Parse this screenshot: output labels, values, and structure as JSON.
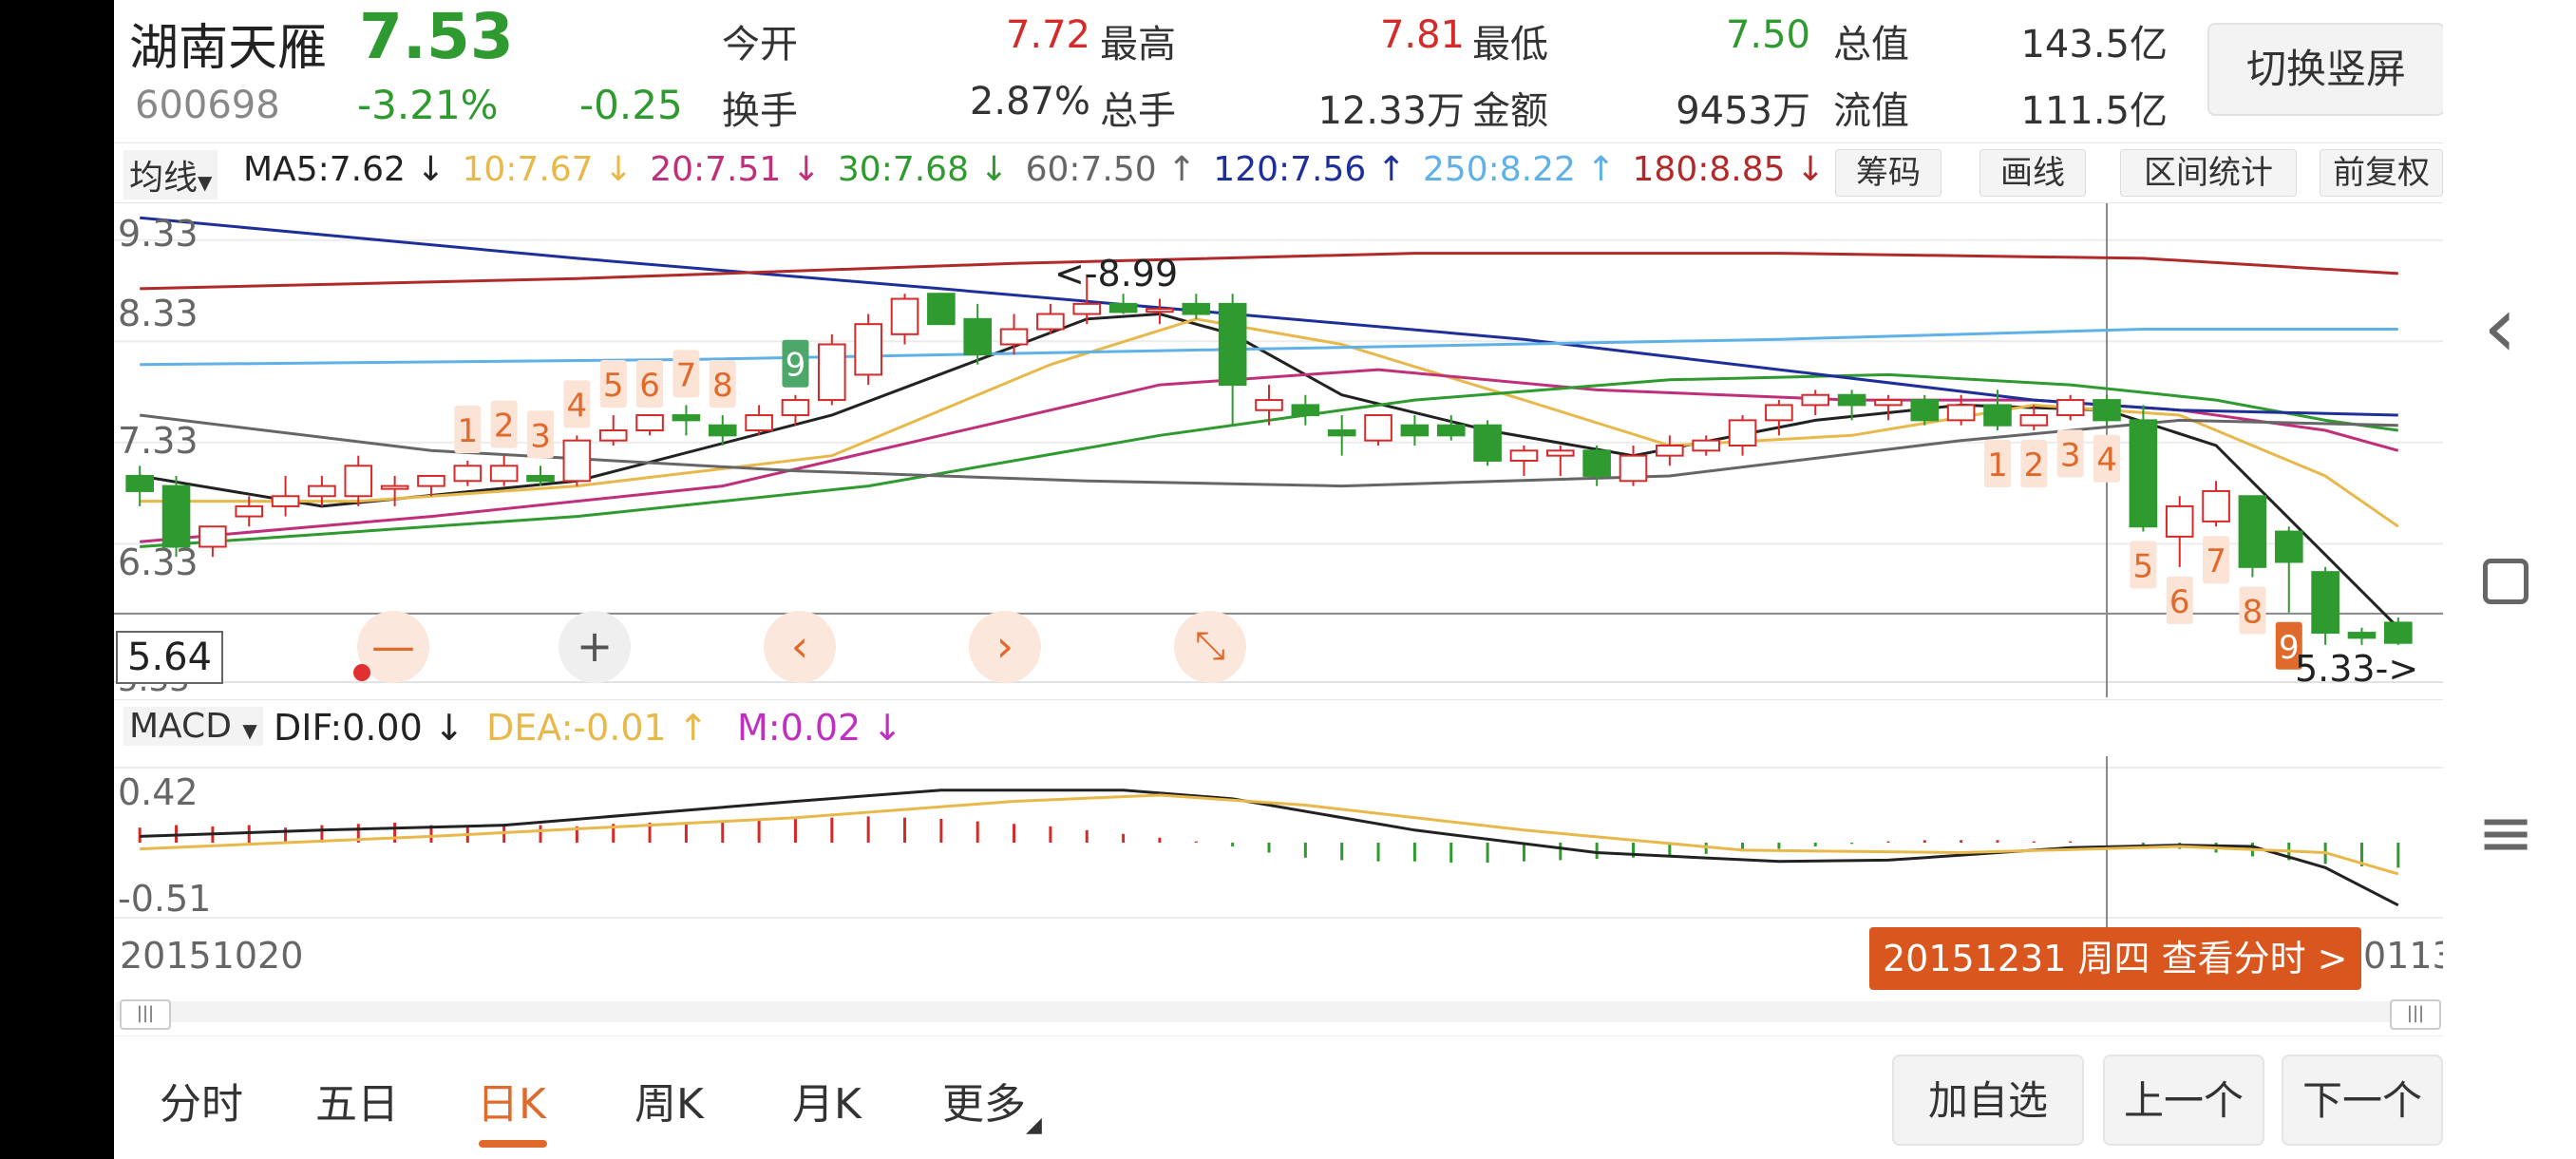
{
  "stock": {
    "name": "湖南天雁",
    "price": "7.53",
    "code": "600698",
    "change_pct": "-3.21%",
    "change": "-0.25"
  },
  "quote": {
    "open_label": "今开",
    "open": "7.72",
    "high_label": "最高",
    "high": "7.81",
    "low_label": "最低",
    "low": "7.50",
    "mcap_label": "总值",
    "mcap": "143.5亿",
    "turnover_label": "换手",
    "turnover": "2.87%",
    "volume_label": "总手",
    "volume": "12.33万",
    "amount_label": "金额",
    "amount": "9453万",
    "float_label": "流值",
    "float": "111.5亿"
  },
  "switch_button": "切换竖屏",
  "ma_bar": {
    "selector": "均线",
    "items": [
      {
        "text": "MA5:7.62 ↓",
        "color": "#222222"
      },
      {
        "text": "10:7.67 ↓",
        "color": "#e8b84a"
      },
      {
        "text": "20:7.51 ↓",
        "color": "#c0307a"
      },
      {
        "text": "30:7.68 ↓",
        "color": "#2f9a2f"
      },
      {
        "text": "60:7.50 ↑",
        "color": "#666666"
      },
      {
        "text": "120:7.56 ↑",
        "color": "#1f2f9a"
      },
      {
        "text": "250:8.22 ↑",
        "color": "#5fb1e8"
      },
      {
        "text": "180:8.85 ↓",
        "color": "#b02a2a"
      }
    ],
    "buttons": [
      "筹码",
      "画线",
      "区间统计",
      "前复权"
    ]
  },
  "chart_axis": {
    "y_ticks": [
      "9.33",
      "8.33",
      "7.33",
      "6.33",
      "5.33"
    ],
    "crosshair_value": "5.64",
    "high_marker": "<-8.99",
    "low_marker": "5.33->"
  },
  "zoom_controls": [
    "—",
    "+",
    "‹",
    "›",
    "⤡"
  ],
  "macd_bar": {
    "selector": "MACD",
    "dif": "DIF:0.00 ↓",
    "dea": "DEA:-0.01 ↑",
    "m": "M:0.02 ↓",
    "y_ticks": [
      "0.42",
      "-0.51"
    ]
  },
  "dates": {
    "start": "20151020",
    "end": "0113",
    "tooltip": "20151231 周四 查看分时 >"
  },
  "colors": {
    "up": "#d52a2a",
    "down": "#2f9a2f",
    "accent": "#e06a2c"
  },
  "chart_data": {
    "type": "candlestick",
    "ylim": [
      5.0,
      9.6
    ],
    "candles": [
      {
        "o": 7.0,
        "h": 7.1,
        "l": 6.7,
        "c": 6.85
      },
      {
        "o": 6.9,
        "h": 7.0,
        "l": 6.2,
        "c": 6.3
      },
      {
        "o": 6.3,
        "h": 6.5,
        "l": 6.2,
        "c": 6.5
      },
      {
        "o": 6.6,
        "h": 6.8,
        "l": 6.5,
        "c": 6.7
      },
      {
        "o": 6.7,
        "h": 7.0,
        "l": 6.6,
        "c": 6.8
      },
      {
        "o": 6.8,
        "h": 7.0,
        "l": 6.7,
        "c": 6.9
      },
      {
        "o": 6.8,
        "h": 7.2,
        "l": 6.7,
        "c": 7.1
      },
      {
        "o": 6.9,
        "h": 7.0,
        "l": 6.7,
        "c": 6.9
      },
      {
        "o": 6.9,
        "h": 7.0,
        "l": 6.8,
        "c": 7.0
      },
      {
        "o": 6.95,
        "h": 7.15,
        "l": 6.9,
        "c": 7.1
      },
      {
        "o": 6.95,
        "h": 7.2,
        "l": 6.9,
        "c": 7.1
      },
      {
        "o": 7.0,
        "h": 7.1,
        "l": 6.9,
        "c": 6.95
      },
      {
        "o": 6.95,
        "h": 7.4,
        "l": 6.9,
        "c": 7.35
      },
      {
        "o": 7.35,
        "h": 7.6,
        "l": 7.3,
        "c": 7.45
      },
      {
        "o": 7.45,
        "h": 7.6,
        "l": 7.4,
        "c": 7.6
      },
      {
        "o": 7.6,
        "h": 7.7,
        "l": 7.4,
        "c": 7.55
      },
      {
        "o": 7.5,
        "h": 7.6,
        "l": 7.3,
        "c": 7.4
      },
      {
        "o": 7.45,
        "h": 7.7,
        "l": 7.4,
        "c": 7.6
      },
      {
        "o": 7.6,
        "h": 7.8,
        "l": 7.5,
        "c": 7.75
      },
      {
        "o": 7.75,
        "h": 8.4,
        "l": 7.7,
        "c": 8.3
      },
      {
        "o": 8.0,
        "h": 8.6,
        "l": 7.9,
        "c": 8.5
      },
      {
        "o": 8.4,
        "h": 8.8,
        "l": 8.3,
        "c": 8.75
      },
      {
        "o": 8.8,
        "h": 8.8,
        "l": 8.5,
        "c": 8.5
      },
      {
        "o": 8.55,
        "h": 8.7,
        "l": 8.1,
        "c": 8.2
      },
      {
        "o": 8.3,
        "h": 8.6,
        "l": 8.2,
        "c": 8.45
      },
      {
        "o": 8.45,
        "h": 8.7,
        "l": 8.4,
        "c": 8.6
      },
      {
        "o": 8.6,
        "h": 8.99,
        "l": 8.5,
        "c": 8.7
      },
      {
        "o": 8.7,
        "h": 8.8,
        "l": 8.6,
        "c": 8.62
      },
      {
        "o": 8.65,
        "h": 8.75,
        "l": 8.5,
        "c": 8.65
      },
      {
        "o": 8.7,
        "h": 8.8,
        "l": 8.55,
        "c": 8.6
      },
      {
        "o": 8.7,
        "h": 8.8,
        "l": 7.5,
        "c": 7.9
      },
      {
        "o": 7.65,
        "h": 7.9,
        "l": 7.5,
        "c": 7.75
      },
      {
        "o": 7.7,
        "h": 7.8,
        "l": 7.5,
        "c": 7.6
      },
      {
        "o": 7.45,
        "h": 7.6,
        "l": 7.2,
        "c": 7.4
      },
      {
        "o": 7.35,
        "h": 7.6,
        "l": 7.3,
        "c": 7.6
      },
      {
        "o": 7.5,
        "h": 7.6,
        "l": 7.3,
        "c": 7.4
      },
      {
        "o": 7.5,
        "h": 7.6,
        "l": 7.35,
        "c": 7.4
      },
      {
        "o": 7.5,
        "h": 7.55,
        "l": 7.1,
        "c": 7.15
      },
      {
        "o": 7.15,
        "h": 7.3,
        "l": 7.0,
        "c": 7.25
      },
      {
        "o": 7.2,
        "h": 7.3,
        "l": 7.0,
        "c": 7.25
      },
      {
        "o": 7.25,
        "h": 7.3,
        "l": 6.9,
        "c": 7.0
      },
      {
        "o": 6.95,
        "h": 7.3,
        "l": 6.9,
        "c": 7.2
      },
      {
        "o": 7.2,
        "h": 7.4,
        "l": 7.1,
        "c": 7.3
      },
      {
        "o": 7.25,
        "h": 7.4,
        "l": 7.2,
        "c": 7.35
      },
      {
        "o": 7.3,
        "h": 7.6,
        "l": 7.2,
        "c": 7.55
      },
      {
        "o": 7.55,
        "h": 7.75,
        "l": 7.4,
        "c": 7.7
      },
      {
        "o": 7.7,
        "h": 7.85,
        "l": 7.6,
        "c": 7.8
      },
      {
        "o": 7.8,
        "h": 7.85,
        "l": 7.55,
        "c": 7.7
      },
      {
        "o": 7.7,
        "h": 7.8,
        "l": 7.55,
        "c": 7.75
      },
      {
        "o": 7.75,
        "h": 7.8,
        "l": 7.5,
        "c": 7.55
      },
      {
        "o": 7.55,
        "h": 7.8,
        "l": 7.5,
        "c": 7.7
      },
      {
        "o": 7.7,
        "h": 7.85,
        "l": 7.45,
        "c": 7.5
      },
      {
        "o": 7.5,
        "h": 7.7,
        "l": 7.45,
        "c": 7.6
      },
      {
        "o": 7.6,
        "h": 7.8,
        "l": 7.55,
        "c": 7.75
      },
      {
        "o": 7.75,
        "h": 7.8,
        "l": 7.5,
        "c": 7.55
      },
      {
        "o": 7.55,
        "h": 7.7,
        "l": 6.45,
        "c": 6.5
      },
      {
        "o": 6.4,
        "h": 6.8,
        "l": 6.1,
        "c": 6.7
      },
      {
        "o": 6.55,
        "h": 6.95,
        "l": 6.5,
        "c": 6.85
      },
      {
        "o": 6.8,
        "h": 6.8,
        "l": 6.0,
        "c": 6.1
      },
      {
        "o": 6.45,
        "h": 6.5,
        "l": 5.65,
        "c": 6.15
      },
      {
        "o": 6.05,
        "h": 6.1,
        "l": 5.33,
        "c": 5.45
      },
      {
        "o": 5.45,
        "h": 5.5,
        "l": 5.33,
        "c": 5.4
      },
      {
        "o": 5.55,
        "h": 5.6,
        "l": 5.33,
        "c": 5.35
      }
    ],
    "ma_series": [
      {
        "name": "MA5",
        "color": "#222222",
        "points": [
          [
            0,
            7.0
          ],
          [
            5,
            6.7
          ],
          [
            12,
            6.95
          ],
          [
            19,
            7.6
          ],
          [
            26,
            8.55
          ],
          [
            28,
            8.6
          ],
          [
            30,
            8.4
          ],
          [
            33,
            7.8
          ],
          [
            37,
            7.45
          ],
          [
            41,
            7.2
          ],
          [
            46,
            7.55
          ],
          [
            50,
            7.7
          ],
          [
            54,
            7.65
          ],
          [
            57,
            7.3
          ],
          [
            62,
            5.5
          ]
        ]
      },
      {
        "name": "MA10",
        "color": "#e8b84a",
        "points": [
          [
            0,
            6.75
          ],
          [
            6,
            6.75
          ],
          [
            12,
            6.9
          ],
          [
            19,
            7.2
          ],
          [
            25,
            8.1
          ],
          [
            29,
            8.55
          ],
          [
            33,
            8.3
          ],
          [
            38,
            7.75
          ],
          [
            42,
            7.3
          ],
          [
            47,
            7.4
          ],
          [
            52,
            7.7
          ],
          [
            56,
            7.6
          ],
          [
            60,
            7.0
          ],
          [
            62,
            6.5
          ]
        ]
      },
      {
        "name": "MA20",
        "color": "#c0307a",
        "points": [
          [
            0,
            6.35
          ],
          [
            8,
            6.6
          ],
          [
            16,
            6.9
          ],
          [
            22,
            7.4
          ],
          [
            28,
            7.9
          ],
          [
            34,
            8.05
          ],
          [
            40,
            7.85
          ],
          [
            47,
            7.75
          ],
          [
            52,
            7.75
          ],
          [
            56,
            7.65
          ],
          [
            60,
            7.45
          ],
          [
            62,
            7.25
          ]
        ]
      },
      {
        "name": "MA30",
        "color": "#2f9a2f",
        "points": [
          [
            0,
            6.3
          ],
          [
            12,
            6.6
          ],
          [
            20,
            6.9
          ],
          [
            28,
            7.4
          ],
          [
            35,
            7.75
          ],
          [
            42,
            7.95
          ],
          [
            48,
            8.0
          ],
          [
            53,
            7.9
          ],
          [
            57,
            7.75
          ],
          [
            60,
            7.55
          ],
          [
            62,
            7.45
          ]
        ]
      },
      {
        "name": "MA60",
        "color": "#666666",
        "points": [
          [
            0,
            7.6
          ],
          [
            8,
            7.25
          ],
          [
            18,
            7.05
          ],
          [
            26,
            6.95
          ],
          [
            33,
            6.9
          ],
          [
            42,
            7.0
          ],
          [
            50,
            7.35
          ],
          [
            56,
            7.55
          ],
          [
            62,
            7.5
          ]
        ]
      },
      {
        "name": "MA120",
        "color": "#1f2f9a",
        "points": [
          [
            0,
            9.55
          ],
          [
            12,
            9.15
          ],
          [
            22,
            8.85
          ],
          [
            30,
            8.6
          ],
          [
            38,
            8.35
          ],
          [
            45,
            8.05
          ],
          [
            52,
            7.75
          ],
          [
            56,
            7.65
          ],
          [
            62,
            7.6
          ]
        ]
      },
      {
        "name": "MA250",
        "color": "#5fb1e8",
        "points": [
          [
            0,
            8.1
          ],
          [
            15,
            8.15
          ],
          [
            30,
            8.25
          ],
          [
            45,
            8.35
          ],
          [
            55,
            8.45
          ],
          [
            62,
            8.45
          ]
        ]
      },
      {
        "name": "MA180",
        "color": "#b02a2a",
        "points": [
          [
            0,
            8.85
          ],
          [
            12,
            8.95
          ],
          [
            24,
            9.1
          ],
          [
            35,
            9.2
          ],
          [
            45,
            9.2
          ],
          [
            55,
            9.15
          ],
          [
            62,
            9.0
          ]
        ]
      }
    ],
    "macd": {
      "ylim": [
        -0.6,
        0.6
      ],
      "bars": [
        0.12,
        0.14,
        0.13,
        0.14,
        0.12,
        0.14,
        0.15,
        0.16,
        0.14,
        0.13,
        0.15,
        0.14,
        0.13,
        0.15,
        0.16,
        0.15,
        0.16,
        0.18,
        0.19,
        0.2,
        0.21,
        0.2,
        0.19,
        0.17,
        0.15,
        0.13,
        0.1,
        0.07,
        0.04,
        0.01,
        -0.03,
        -0.08,
        -0.12,
        -0.14,
        -0.15,
        -0.15,
        -0.16,
        -0.16,
        -0.15,
        -0.14,
        -0.13,
        -0.12,
        -0.11,
        -0.09,
        -0.07,
        -0.05,
        -0.03,
        -0.01,
        0.01,
        0.02,
        0.02,
        0.02,
        0.01,
        0.01,
        0.0,
        -0.02,
        -0.05,
        -0.08,
        -0.11,
        -0.14,
        -0.17,
        -0.19,
        -0.2
      ],
      "dif": [
        [
          0,
          0.05
        ],
        [
          5,
          0.1
        ],
        [
          10,
          0.14
        ],
        [
          18,
          0.33
        ],
        [
          22,
          0.42
        ],
        [
          27,
          0.42
        ],
        [
          30,
          0.35
        ],
        [
          35,
          0.1
        ],
        [
          40,
          -0.08
        ],
        [
          45,
          -0.15
        ],
        [
          48,
          -0.14
        ],
        [
          53,
          -0.04
        ],
        [
          56,
          -0.02
        ],
        [
          58,
          -0.03
        ],
        [
          60,
          -0.2
        ],
        [
          62,
          -0.5
        ]
      ],
      "dea": [
        [
          0,
          -0.05
        ],
        [
          8,
          0.05
        ],
        [
          18,
          0.2
        ],
        [
          24,
          0.33
        ],
        [
          28,
          0.38
        ],
        [
          32,
          0.3
        ],
        [
          38,
          0.1
        ],
        [
          44,
          -0.06
        ],
        [
          50,
          -0.08
        ],
        [
          56,
          -0.03
        ],
        [
          60,
          -0.08
        ],
        [
          62,
          -0.25
        ]
      ]
    },
    "tag_labels": [
      {
        "i": 9,
        "text": "1"
      },
      {
        "i": 10,
        "text": "2"
      },
      {
        "i": 11,
        "text": "3"
      },
      {
        "i": 12,
        "text": "4"
      },
      {
        "i": 13,
        "text": "5"
      },
      {
        "i": 14,
        "text": "6"
      },
      {
        "i": 15,
        "text": "7"
      },
      {
        "i": 16,
        "text": "8"
      },
      {
        "i": 18,
        "text": "9"
      },
      {
        "i": 51,
        "text": "1"
      },
      {
        "i": 52,
        "text": "2"
      },
      {
        "i": 53,
        "text": "3"
      },
      {
        "i": 54,
        "text": "4"
      },
      {
        "i": 55,
        "text": "5"
      },
      {
        "i": 56,
        "text": "6"
      },
      {
        "i": 57,
        "text": "7"
      },
      {
        "i": 58,
        "text": "8"
      },
      {
        "i": 59,
        "text": "9"
      }
    ]
  },
  "tabs": [
    "分时",
    "五日",
    "日K",
    "周K",
    "月K",
    "更多"
  ],
  "active_tab": "日K",
  "nav_buttons": [
    "加自选",
    "上一个",
    "下一个"
  ],
  "sidebar": {
    "back": "‹",
    "square": "□",
    "menu": "≡"
  }
}
